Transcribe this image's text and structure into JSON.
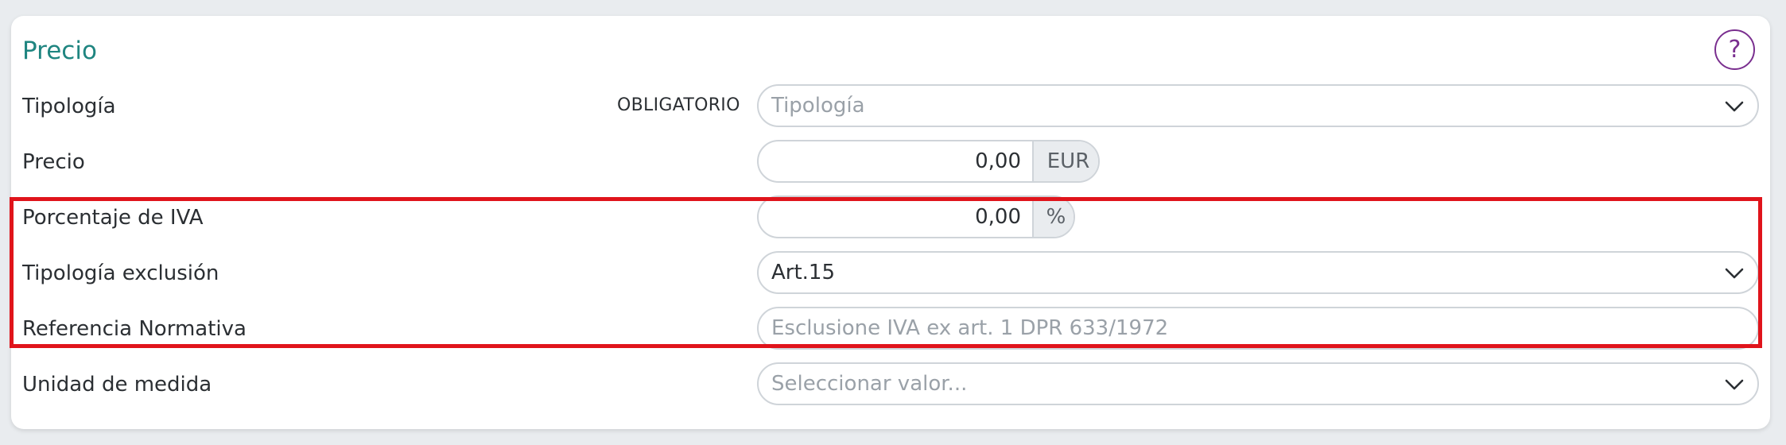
{
  "section": {
    "title": "Precio",
    "help_symbol": "?"
  },
  "fields": {
    "tipologia": {
      "label": "Tipología",
      "required_label": "OBLIGATORIO",
      "placeholder": "Tipología"
    },
    "precio": {
      "label": "Precio",
      "value": "0,00",
      "unit": "EUR"
    },
    "porcentaje_iva": {
      "label": "Porcentaje de IVA",
      "value": "0,00",
      "unit": "%"
    },
    "tipologia_exclusion": {
      "label": "Tipología exclusión",
      "value": "Art.15"
    },
    "referencia_normativa": {
      "label": "Referencia Normativa",
      "placeholder": "Esclusione IVA ex art. 1 DPR 633/1972"
    },
    "unidad_medida": {
      "label": "Unidad de medida",
      "placeholder": "Seleccionar valor..."
    }
  },
  "colors": {
    "title": "#1f8580",
    "help": "#7a2f8f",
    "highlight": "#e0141b"
  }
}
